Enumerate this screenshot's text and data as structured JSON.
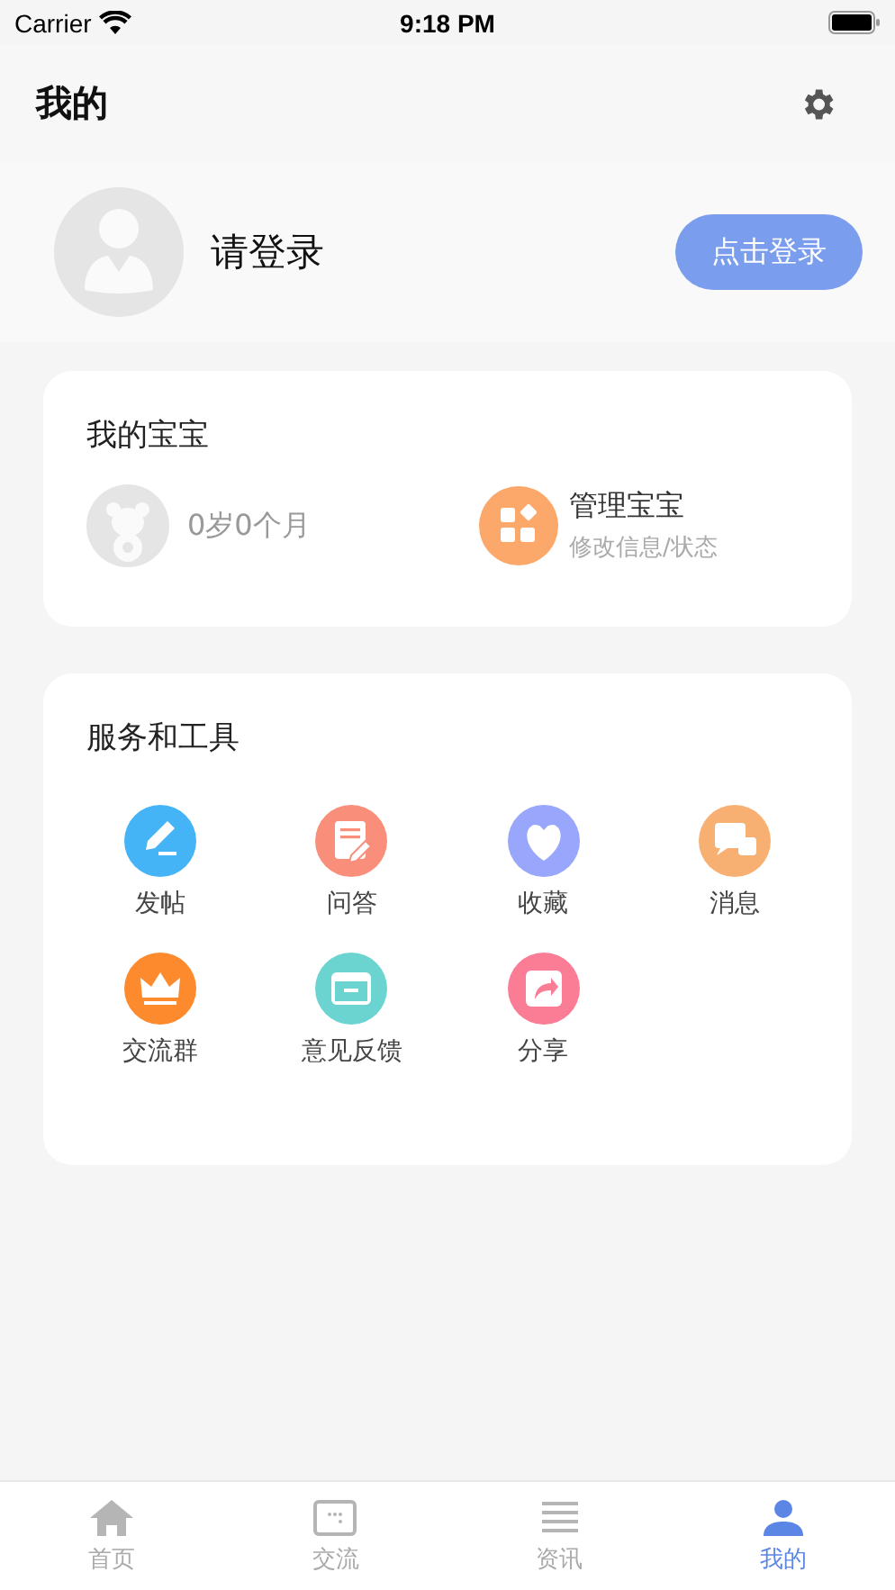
{
  "status_bar": {
    "carrier": "Carrier",
    "time": "9:18 PM"
  },
  "header": {
    "title": "我的"
  },
  "profile": {
    "name": "请登录",
    "login_button": "点击登录"
  },
  "baby_card": {
    "title": "我的宝宝",
    "age": "0岁0个月",
    "manage_title": "管理宝宝",
    "manage_subtitle": "修改信息/状态"
  },
  "services": {
    "title": "服务和工具",
    "tools": [
      {
        "label": "发帖",
        "kind": "post"
      },
      {
        "label": "问答",
        "kind": "qa"
      },
      {
        "label": "收藏",
        "kind": "favorite"
      },
      {
        "label": "消息",
        "kind": "message"
      },
      {
        "label": "交流群",
        "kind": "group"
      },
      {
        "label": "意见反馈",
        "kind": "feedback"
      },
      {
        "label": "分享",
        "kind": "share"
      }
    ]
  },
  "tab_bar": [
    {
      "label": "首页",
      "kind": "home",
      "selected": false
    },
    {
      "label": "交流",
      "kind": "chat",
      "selected": false
    },
    {
      "label": "资讯",
      "kind": "news",
      "selected": false
    },
    {
      "label": "我的",
      "kind": "me",
      "selected": true
    }
  ]
}
